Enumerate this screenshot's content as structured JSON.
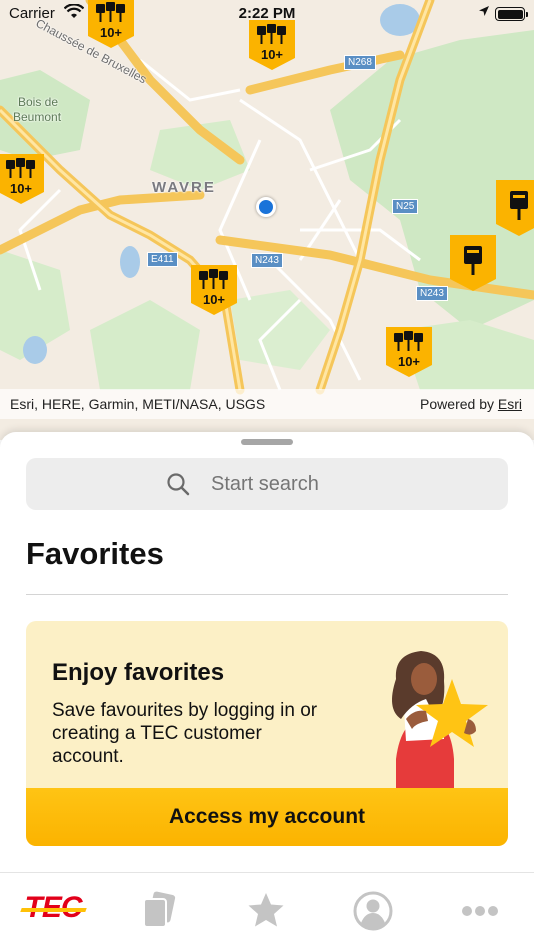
{
  "status_bar": {
    "carrier": "Carrier",
    "time": "2:22 PM"
  },
  "map": {
    "labels": {
      "chaussee": "Chaussée de Bruxelles",
      "forest_line1": "Bois de",
      "forest_line2": "Beumont",
      "city": "WAVRE"
    },
    "road_shields": [
      "N268",
      "N25",
      "E411",
      "N243",
      "N243"
    ],
    "stop_clusters": [
      {
        "count": "10+"
      },
      {
        "count": "10+"
      },
      {
        "count": "10+"
      },
      {
        "count": "10+"
      },
      {
        "count": "10+"
      }
    ],
    "attribution": "Esri, HERE, Garmin, METI/NASA, USGS",
    "powered_by": "Powered by",
    "powered_by_link": "Esri"
  },
  "sheet": {
    "search_placeholder": "Start search",
    "favorites_title": "Favorites",
    "promo": {
      "title": "Enjoy favorites",
      "text": "Save favourites by logging in or creating a TEC customer account.",
      "button_label": "Access my account"
    }
  },
  "tabbar": {
    "logo_text": "TEC",
    "tabs": [
      "home",
      "tickets",
      "favorites",
      "account",
      "more"
    ]
  },
  "colors": {
    "accent": "#fbb300",
    "brand_red": "#e2001a",
    "promo_bg": "#fcf0c6"
  },
  "icons": [
    "wifi-icon",
    "location-arrow-icon",
    "battery-icon",
    "bus-stop-icon",
    "search-icon",
    "tickets-icon",
    "star-icon",
    "user-icon",
    "more-icon"
  ]
}
